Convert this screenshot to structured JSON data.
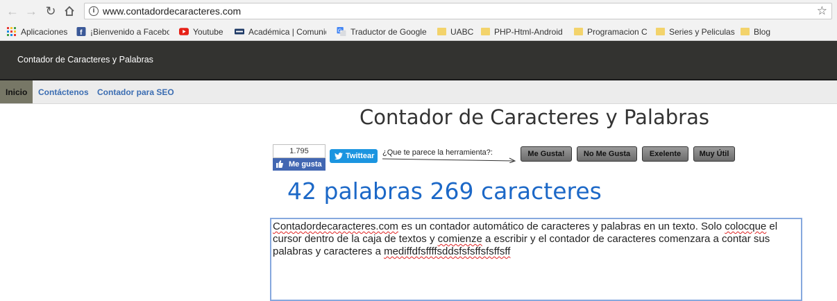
{
  "browser": {
    "url": "www.contadordecaracteres.com",
    "bookmarks": [
      {
        "label": "Aplicaciones",
        "icon": "apps-grid-icon"
      },
      {
        "label": "¡Bienvenido a Facebo",
        "icon": "facebook-icon"
      },
      {
        "label": "Youtube",
        "icon": "youtube-icon"
      },
      {
        "label": "Académica | Comunid",
        "icon": "academica-icon"
      },
      {
        "label": "Traductor de Google",
        "icon": "google-translate-icon"
      },
      {
        "label": "UABC",
        "icon": "folder-icon"
      },
      {
        "label": "PHP-Html-Android",
        "icon": "folder-icon"
      },
      {
        "label": "Programacion C",
        "icon": "folder-icon"
      },
      {
        "label": "Series y Peliculas",
        "icon": "folder-icon"
      },
      {
        "label": "Blog",
        "icon": "folder-icon"
      }
    ]
  },
  "site": {
    "title": "Contador de Caracteres y Palabras",
    "nav": [
      "Inicio",
      "Contáctenos",
      "Contador para SEO"
    ]
  },
  "main": {
    "title": "Contador de Caracteres y Palabras",
    "fb_count": "1.795",
    "fb_like": "Me gusta",
    "twitter": "Twittear",
    "question": "¿Que te parece la herramienta?:",
    "votes": [
      "Me Gusta!",
      "No Me Gusta",
      "Exelente",
      "Muy Útil"
    ],
    "word_count": "42",
    "words_label": "palabras",
    "char_count": "269",
    "chars_label": "caracteres",
    "text": {
      "p1": "Contadordecaracteres.com",
      "p2": " es un contador automático de caracteres y palabras en un texto. Solo ",
      "p3": "colocque",
      "p4": " el cursor dentro de la caja de textos y ",
      "p5": "comienze",
      "p6": " a escribir y el contador de caracteres comenzara a contar sus palabras y caracteres a ",
      "p7": "mediffdfsffffsddsfsfsffsfsffsff"
    }
  },
  "colors": {
    "header_bg": "#333330",
    "nav_active": "#777766",
    "count_blue": "#1c68c7",
    "facebook": "#4267b2",
    "twitter": "#1b95e0"
  }
}
